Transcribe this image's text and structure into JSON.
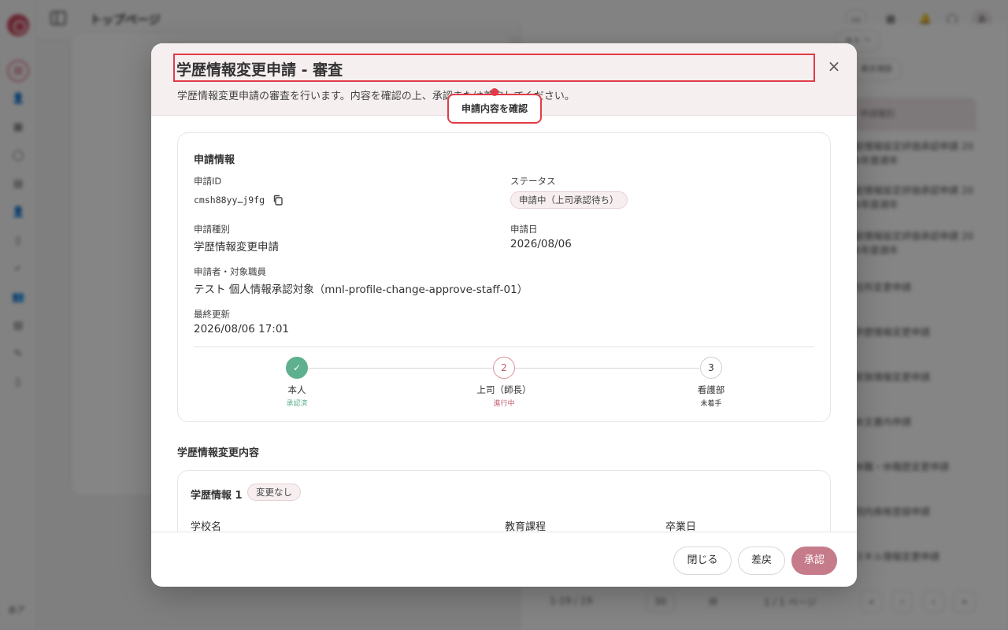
{
  "app": {
    "page_title": "トップページ",
    "user_initials": "あ",
    "rail_user_initials": "あア"
  },
  "background": {
    "pill_1": "ゅぇ ー",
    "pill_2": "表示項目",
    "table_head": "申請種別",
    "rows": [
      "能情報設定評価承認申請 20",
      "6年度適年",
      "能情報設定評価承認申請 20",
      "6年度適年",
      "能情報設定評価承認申請 20",
      "6年度適年",
      "住所変更申請",
      "学歴情報変更申請",
      "家族情報変更申請",
      "本文書内申請",
      "休職・休職歴変更申請",
      "院内資格登録申請",
      "スキル情報変更申請"
    ],
    "footer": {
      "range": "1-19 / 19",
      "per_page": "30",
      "per_page_unit": "件",
      "page": "1 / 1 ページ"
    }
  },
  "modal": {
    "title": "学歴情報変更申請 - 審査",
    "description": "学歴情報変更申請の審査を行います。内容を確認の上、承認または差戻してください。",
    "tooltip": "申請内容を確認",
    "info_card": {
      "title": "申請情報",
      "request_id_label": "申請ID",
      "request_id": "cmsh88yy…j9fg",
      "status_label": "ステータス",
      "status": "申請中（上司承認待ち）",
      "type_label": "申請種別",
      "type": "学歴情報変更申請",
      "date_label": "申請日",
      "date": "2026/08/06",
      "applicant_label": "申請者・対象職員",
      "applicant": "テスト 個人情報承認対象（mnl-profile-change-approve-staff-01）",
      "updated_label": "最終更新",
      "updated": "2026/08/06 17:01"
    },
    "steps": [
      {
        "number": "✓",
        "label": "本人",
        "status": "承認済",
        "state": "done",
        "color": "#5fb08e"
      },
      {
        "number": "2",
        "label": "上司（師長）",
        "status": "進行中",
        "state": "active",
        "color": "#c05a6a"
      },
      {
        "number": "3",
        "label": "看護部",
        "status": "未着手",
        "state": "todo",
        "color": "#333333"
      }
    ],
    "edu_section_title": "学歴情報変更内容",
    "edu_card": {
      "title": "学歴情報 1",
      "badge": "変更なし",
      "col_school": "学校名",
      "col_course": "教育課程",
      "col_graduation": "卒業日"
    },
    "buttons": {
      "close": "閉じる",
      "return": "差戻",
      "approve": "承認"
    }
  },
  "colors": {
    "accent": "#c67b8a",
    "highlight": "#e23b47",
    "done": "#5fb08e"
  }
}
